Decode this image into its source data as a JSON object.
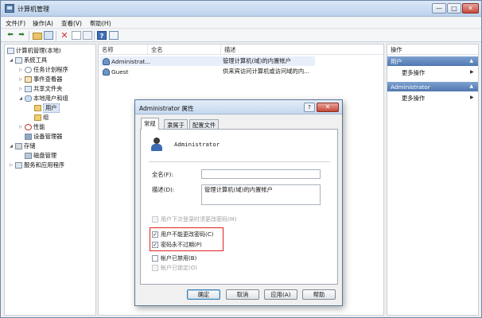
{
  "window": {
    "title": "计算机管理",
    "controls": {
      "minimize": "—",
      "maximize": "□",
      "close": "✕"
    }
  },
  "menu": {
    "items": [
      "文件(F)",
      "操作(A)",
      "查看(V)",
      "帮助(H)"
    ]
  },
  "toolbar": {
    "icons": [
      "back-arrow-icon",
      "forward-arrow-icon",
      "folder-up-icon",
      "show-hide-tree-icon",
      "delete-icon",
      "properties-icon",
      "refresh-icon",
      "help-icon",
      "action-pane-icon"
    ],
    "back_glyph": "⬅",
    "forward_glyph": "➡",
    "delete_glyph": "✕",
    "help_glyph": "?"
  },
  "tree": {
    "root": "计算机管理(本地)",
    "system_tools": "系统工具",
    "task_scheduler": "任务计划程序",
    "event_viewer": "事件查看器",
    "shared_folders": "共享文件夹",
    "local_users_groups": "本地用户和组",
    "users": "用户",
    "groups": "组",
    "performance": "性能",
    "device_manager": "设备管理器",
    "storage": "存储",
    "disk_management": "磁盘管理",
    "services_apps": "服务和应用程序"
  },
  "list": {
    "headers": [
      "名称",
      "全名",
      "描述"
    ],
    "rows": [
      {
        "name": "Administrat...",
        "fullname": "",
        "description": "管理计算机(域)的内置帐户"
      },
      {
        "name": "Guest",
        "fullname": "",
        "description": "供来宾访问计算机或访问域的内..."
      }
    ]
  },
  "actions": {
    "title": "操作",
    "sections": [
      {
        "label": "用户",
        "item": "更多操作"
      },
      {
        "label": "Administrator",
        "item": "更多操作"
      }
    ],
    "chevron": "▲",
    "arrow": "▶"
  },
  "dialog": {
    "title": "Administrator 属性",
    "help": "?",
    "close": "✕",
    "tabs": [
      "常规",
      "隶属于",
      "配置文件"
    ],
    "username": "Administrator",
    "fullname_label": "全名(F):",
    "fullname_value": "",
    "description_label": "描述(D):",
    "description_value": "管理计算机(域)的内置帐户",
    "checkboxes": [
      {
        "label": "用户下次登录时须更改密码(M)",
        "checked": false,
        "disabled": true
      },
      {
        "label": "用户不能更改密码(C)",
        "checked": true,
        "disabled": false
      },
      {
        "label": "密码永不过期(P)",
        "checked": true,
        "disabled": false
      },
      {
        "label": "帐户已禁用(B)",
        "checked": false,
        "disabled": false
      },
      {
        "label": "帐户已锁定(O)",
        "checked": false,
        "disabled": true
      }
    ],
    "check_glyph": "✓",
    "buttons": {
      "ok": "确定",
      "cancel": "取消",
      "apply": "应用(A)",
      "help": "帮助"
    },
    "highlight_color": "#e02020"
  }
}
